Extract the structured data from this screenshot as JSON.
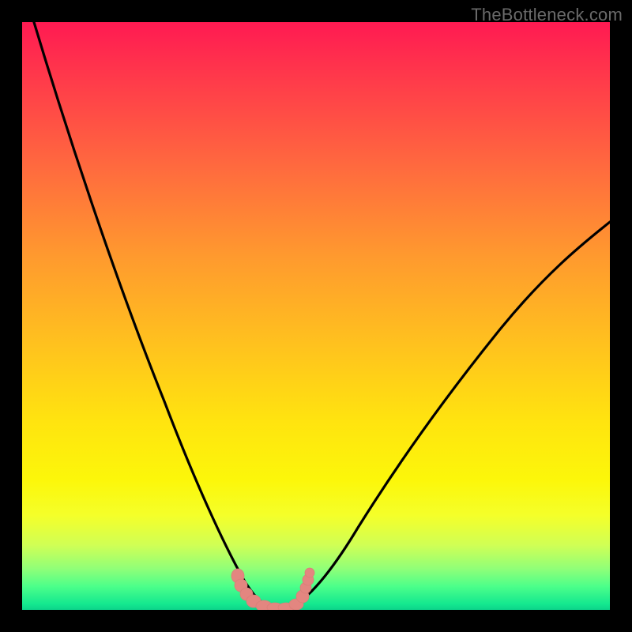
{
  "watermark": "TheBottleneck.com",
  "chart_data": {
    "type": "line",
    "title": "",
    "xlabel": "",
    "ylabel": "",
    "xlim": [
      0,
      100
    ],
    "ylim": [
      0,
      100
    ],
    "series": [
      {
        "name": "left-curve",
        "x": [
          2,
          5,
          9,
          14,
          20,
          26,
          31,
          35,
          37,
          38.5,
          40,
          42,
          44
        ],
        "y": [
          100,
          84,
          67,
          50,
          33,
          18,
          9,
          3,
          1.5,
          0.6,
          0.4,
          0.3,
          0.3
        ]
      },
      {
        "name": "right-curve",
        "x": [
          44,
          46,
          48,
          50,
          53,
          58,
          64,
          72,
          82,
          92,
          100
        ],
        "y": [
          0.3,
          0.4,
          0.9,
          2.5,
          6,
          12,
          21,
          33,
          47,
          58,
          66
        ]
      },
      {
        "name": "floor-markers",
        "x": [
          36.5,
          37.2,
          38,
          39,
          40.5,
          42,
          43.5,
          45,
          46.5,
          47.5,
          48,
          48.5
        ],
        "y": [
          6,
          4.5,
          3,
          1.8,
          1.2,
          1.0,
          1.0,
          1.2,
          1.8,
          3.2,
          4.5,
          6
        ]
      }
    ],
    "colors": {
      "curve": "#000000",
      "markers": "#e38680",
      "background_top": "#ff1a52",
      "background_mid": "#ffe40f",
      "background_bottom": "#14e88f",
      "frame": "#000000"
    }
  }
}
